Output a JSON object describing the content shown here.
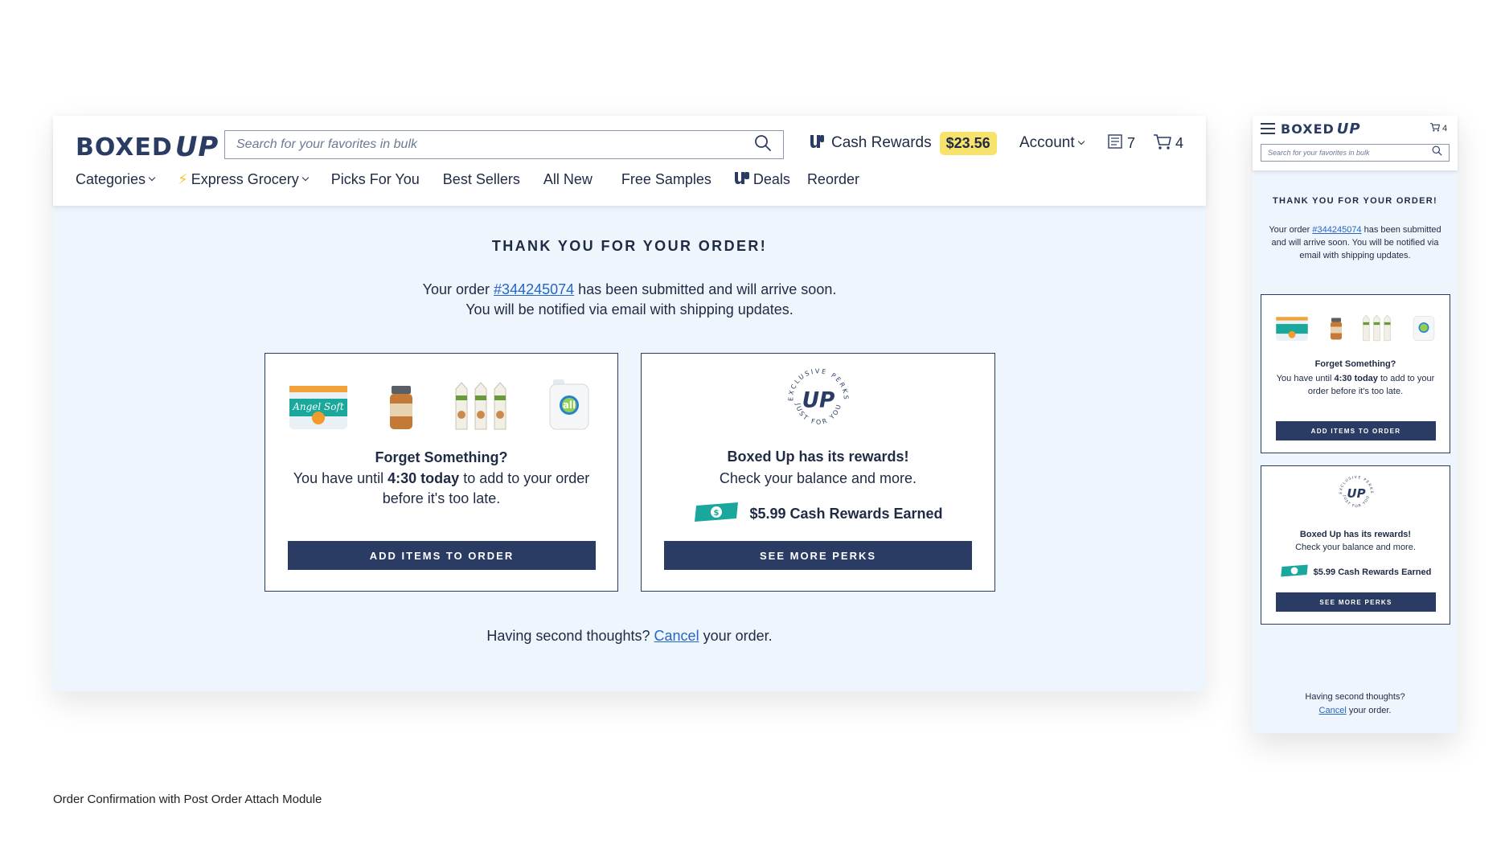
{
  "brand": {
    "logo_text": "BOXED",
    "logo_up": "UP"
  },
  "search": {
    "placeholder": "Search for your favorites in bulk"
  },
  "header": {
    "cash_rewards_label": "Cash Rewards",
    "cash_rewards_amount": "$23.56",
    "account_label": "Account",
    "orders_count": "7",
    "cart_count": "4"
  },
  "nav": {
    "categories": "Categories",
    "express_grocery": "Express Grocery",
    "picks_for_you": "Picks For You",
    "best_sellers": "Best Sellers",
    "all_new": "All New",
    "free_samples": "Free Samples",
    "deals": "Deals",
    "reorder": "Reorder"
  },
  "confirmation": {
    "title": "THANK YOU FOR YOUR ORDER!",
    "order_prefix": "Your order ",
    "order_number": "#344245074",
    "order_suffix": " has been submitted and will arrive soon.",
    "email_note": "You will be notified via email with shipping updates."
  },
  "mobile_confirmation": {
    "order_suffix": " has been submitted and will arrive soon. You will be notified via email with shipping updates."
  },
  "attach_card": {
    "heading": "Forget Something?",
    "text_prefix": "You have until ",
    "deadline": "4:30 today",
    "text_suffix": " to add to your order before it's too late.",
    "button": "ADD ITEMS TO ORDER"
  },
  "rewards_card": {
    "badge_ring_top": "EXCLUSIVE PERKS",
    "badge_ring_bottom": "JUST FOR YOU",
    "badge_center": "UP",
    "heading": "Boxed Up has its rewards!",
    "text": "Check your balance and more.",
    "earned": "$5.99 Cash Rewards Earned",
    "button": "SEE MORE PERKS"
  },
  "products": [
    {
      "name": "Angel Soft toilet paper",
      "icon": "toilet-paper-icon",
      "label": "Angel Soft"
    },
    {
      "name": "Peanut butter jar",
      "icon": "peanut-butter-icon",
      "label": ""
    },
    {
      "name": "Almond milk cartons",
      "icon": "milk-cartons-icon",
      "label": ""
    },
    {
      "name": "all laundry detergent",
      "icon": "detergent-icon",
      "label": "all"
    }
  ],
  "footer": {
    "prefix": "Having second thoughts? ",
    "cancel_link": "Cancel",
    "suffix": " your order."
  },
  "caption": "Order Confirmation with Post Order Attach Module",
  "colors": {
    "navy": "#2a3c63",
    "page_bg": "#eef5fc",
    "link": "#2466c9",
    "badge_yellow": "#f7e26b",
    "teal": "#1aa89c"
  }
}
